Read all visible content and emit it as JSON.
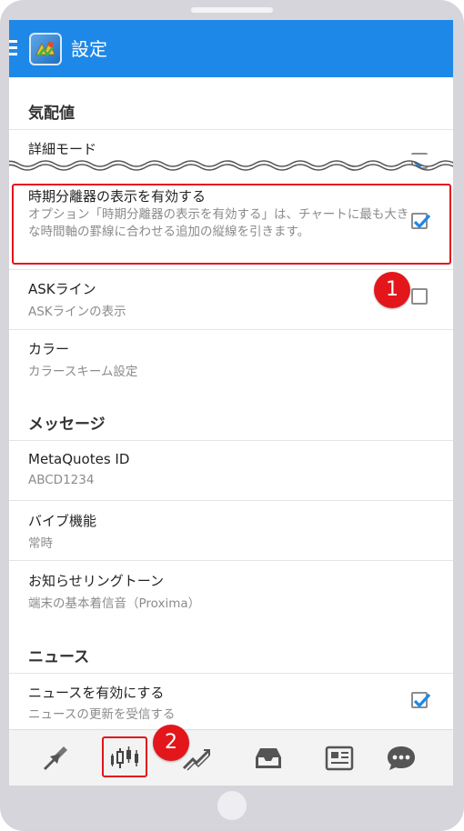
{
  "header": {
    "title": "設定",
    "app_icon": "metatrader-logo-icon",
    "menu_icon": "hamburger-menu-icon"
  },
  "sections": {
    "quotes": {
      "title": "気配値",
      "detail_mode": {
        "title": "詳細モード",
        "checked": true
      }
    },
    "chart": {
      "period_separators": {
        "title": "時期分離器の表示を有効する",
        "description": "オプション「時期分離器の表示を有効する」は、チャートに最も大きな時間軸の罫線に合わせる追加の縦線を引きます。",
        "checked": true
      },
      "ask_line": {
        "title": "ASKライン",
        "subtitle": "ASKラインの表示",
        "checked": false
      },
      "colors": {
        "title": "カラー",
        "subtitle": "カラースキーム設定"
      }
    },
    "messages": {
      "title": "メッセージ",
      "metaquotes_id": {
        "title": "MetaQuotes ID",
        "value": "ABCD1234"
      },
      "vibration": {
        "title": "バイブ機能",
        "value": "常時"
      },
      "ringtone": {
        "title": "お知らせリングトーン",
        "value": "端末の基本着信音（Proxima）"
      }
    },
    "news": {
      "title": "ニュース",
      "enable_news": {
        "title": "ニュースを有効にする",
        "subtitle": "ニュースの更新を受信する",
        "checked": true
      }
    }
  },
  "annotations": {
    "badge_1": "1",
    "badge_2": "2",
    "color": "#e3171b"
  },
  "bottom_nav": [
    {
      "name": "nav-quotes",
      "icon": "trade-arrows-icon"
    },
    {
      "name": "nav-chart",
      "icon": "candlestick-chart-icon"
    },
    {
      "name": "nav-trade",
      "icon": "trend-line-icon"
    },
    {
      "name": "nav-history",
      "icon": "inbox-tray-icon"
    },
    {
      "name": "nav-news",
      "icon": "newspaper-icon"
    },
    {
      "name": "nav-messages",
      "icon": "chat-bubble-icon"
    }
  ],
  "colors": {
    "accent": "#1e88e8",
    "check": "#1e88e8",
    "highlight": "#e2141b"
  }
}
